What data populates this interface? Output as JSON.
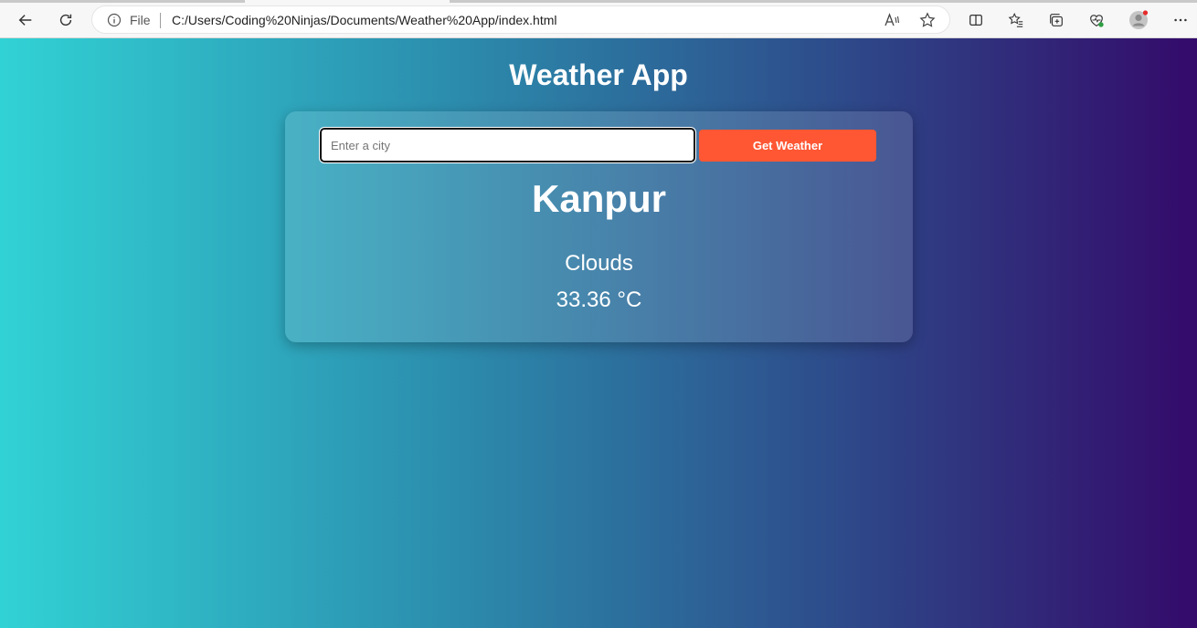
{
  "browser": {
    "address_scheme_label": "File",
    "url": "C:/Users/Coding%20Ninjas/Documents/Weather%20App/index.html"
  },
  "app": {
    "title": "Weather App",
    "search": {
      "placeholder": "Enter a city",
      "value": "",
      "button_label": "Get Weather"
    },
    "result": {
      "city": "Kanpur",
      "description": "Clouds",
      "temperature": "33.36 °C"
    }
  },
  "colors": {
    "button": "#ff5733",
    "gradient_start": "#31d2d5",
    "gradient_end": "#340a6a"
  }
}
